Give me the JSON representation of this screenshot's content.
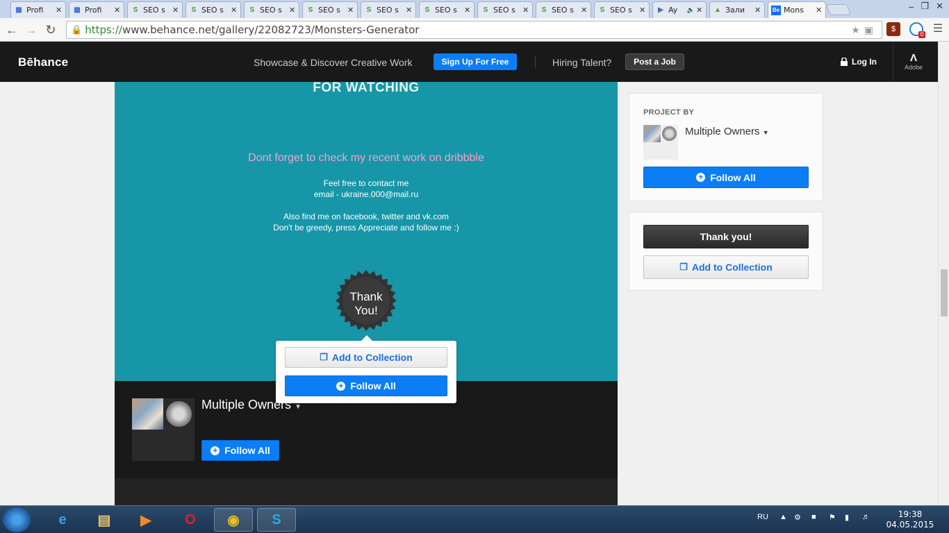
{
  "browser": {
    "tabs": [
      {
        "title": "Profi",
        "icon": "chart-icon",
        "icon_color": "#3b6fd8"
      },
      {
        "title": "Profi",
        "icon": "chart-icon",
        "icon_color": "#3b6fd8"
      },
      {
        "title": "SEO s",
        "icon": "seo-icon",
        "icon_color": "#3b9a3b"
      },
      {
        "title": "SEO s",
        "icon": "seo-icon",
        "icon_color": "#3b9a3b"
      },
      {
        "title": "SEO s",
        "icon": "seo-icon",
        "icon_color": "#3b9a3b"
      },
      {
        "title": "SEO s",
        "icon": "seo-icon",
        "icon_color": "#3b9a3b"
      },
      {
        "title": "SEO s",
        "icon": "seo-icon",
        "icon_color": "#3b9a3b"
      },
      {
        "title": "SEO s",
        "icon": "seo-icon",
        "icon_color": "#3b9a3b"
      },
      {
        "title": "SEO s",
        "icon": "seo-icon",
        "icon_color": "#3b9a3b"
      },
      {
        "title": "SEO s",
        "icon": "seo-icon",
        "icon_color": "#3b9a3b"
      },
      {
        "title": "SEO s",
        "icon": "seo-icon",
        "icon_color": "#3b9a3b"
      },
      {
        "title": "Ay",
        "icon": "play-icon",
        "icon_color": "#4a6fa0"
      },
      {
        "title": "Зали",
        "icon": "image-icon",
        "icon_color": "#6a8a3a"
      },
      {
        "title": "Mons",
        "icon": "behance-icon",
        "icon_color": "#1769ff"
      }
    ],
    "url_scheme": "https://",
    "url_rest": "www.behance.net/gallery/22082723/Monsters-Generator",
    "ext_badge": "0"
  },
  "header": {
    "logo": "Bēhance",
    "tagline": "Showcase & Discover Creative Work",
    "signup": "Sign Up For Free",
    "hiring": "Hiring Talent?",
    "post_job": "Post a Job",
    "login": "Log In",
    "adobe": "Adobe"
  },
  "project": {
    "for_watching": "FOR WATCHING",
    "dribbble": "Dont forget to check my recent work on dribbble",
    "contact_1": "Feel free to contact me",
    "contact_2": "email - ukraine.000@mail.ru",
    "social_1": "Also find me on facebook, twitter and vk.com",
    "social_2": "Don't be greedy, press Appreciate and follow me :)",
    "badge_1": "Thank",
    "badge_2": "You!",
    "owners": "Multiple Owners"
  },
  "popup": {
    "add_collection": "Add to Collection",
    "follow_all": "Follow All"
  },
  "dark_footer": {
    "owners": "Multiple Owners",
    "follow_all": "Follow All"
  },
  "sidebar": {
    "project_by": "PROJECT BY",
    "owners": "Multiple Owners",
    "follow_all": "Follow All",
    "thank_you": "Thank you!",
    "add_collection": "Add to Collection"
  },
  "taskbar": {
    "lang": "RU",
    "time": "19:38",
    "date": "04.05.2015"
  },
  "colors": {
    "teal": "#1796a8",
    "behance_blue": "#0b7ef5",
    "dribbble_pink": "#f4a3c9"
  }
}
